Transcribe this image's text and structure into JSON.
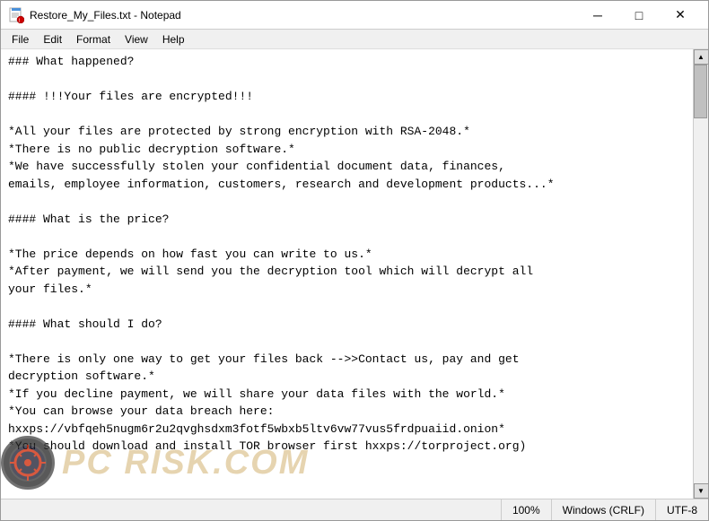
{
  "window": {
    "title": "Restore_My_Files.txt - Notepad",
    "icon": "notepad"
  },
  "titlebar": {
    "minimize_label": "─",
    "maximize_label": "□",
    "close_label": "✕"
  },
  "menubar": {
    "items": [
      "File",
      "Edit",
      "Format",
      "View",
      "Help"
    ]
  },
  "content": {
    "text": "### What happened?\n\n#### !!!Your files are encrypted!!!\n\n*All your files are protected by strong encryption with RSA-2048.*\n*There is no public decryption software.*\n*We have successfully stolen your confidential document data, finances,\nemails, employee information, customers, research and development products...*\n\n#### What is the price?\n\n*The price depends on how fast you can write to us.*\n*After payment, we will send you the decryption tool which will decrypt all\nyour files.*\n\n#### What should I do?\n\n*There is only one way to get your files back -->>Contact us, pay and get\ndecryption software.*\n*If you decline payment, we will share your data files with the world.*\n*You can browse your data breach here:\nhxxps://vbfqeh5nugm6r2u2qvghsdxm3fotf5wbxb5ltv6vw77vus5frdpuaiid.onion*\n*You should download and install TOR browser first hxxps://torproject.org)"
  },
  "statusbar": {
    "zoom": "100%",
    "line_ending": "Windows (CRLF)",
    "encoding": "UTF-8"
  },
  "watermark": {
    "text": "PC RISK.COM"
  }
}
